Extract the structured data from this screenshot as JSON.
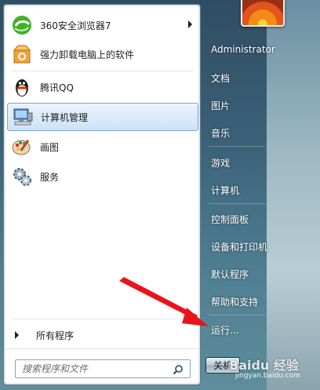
{
  "programs": [
    {
      "label": "360安全浏览器7",
      "has_submenu": true
    },
    {
      "label": "强力卸载电脑上的软件"
    },
    {
      "label": "腾讯QQ"
    },
    {
      "label": "计算机管理",
      "selected": true
    },
    {
      "label": "画图"
    },
    {
      "label": "服务"
    }
  ],
  "all_programs_label": "所有程序",
  "search": {
    "placeholder": "搜索程序和文件"
  },
  "right_pane": {
    "user_name": "Administrator",
    "items": [
      "文档",
      "图片",
      "音乐",
      "游戏",
      "计算机",
      "控制面板",
      "设备和打印机",
      "默认程序",
      "帮助和支持",
      "运行..."
    ]
  },
  "shutdown_label": "关机",
  "watermark": {
    "main": "Baidu 经验",
    "sub": "jingyan.baidu.com"
  },
  "colors": {
    "annotation_arrow": "#e8141c",
    "selection": "#cde2f7"
  }
}
